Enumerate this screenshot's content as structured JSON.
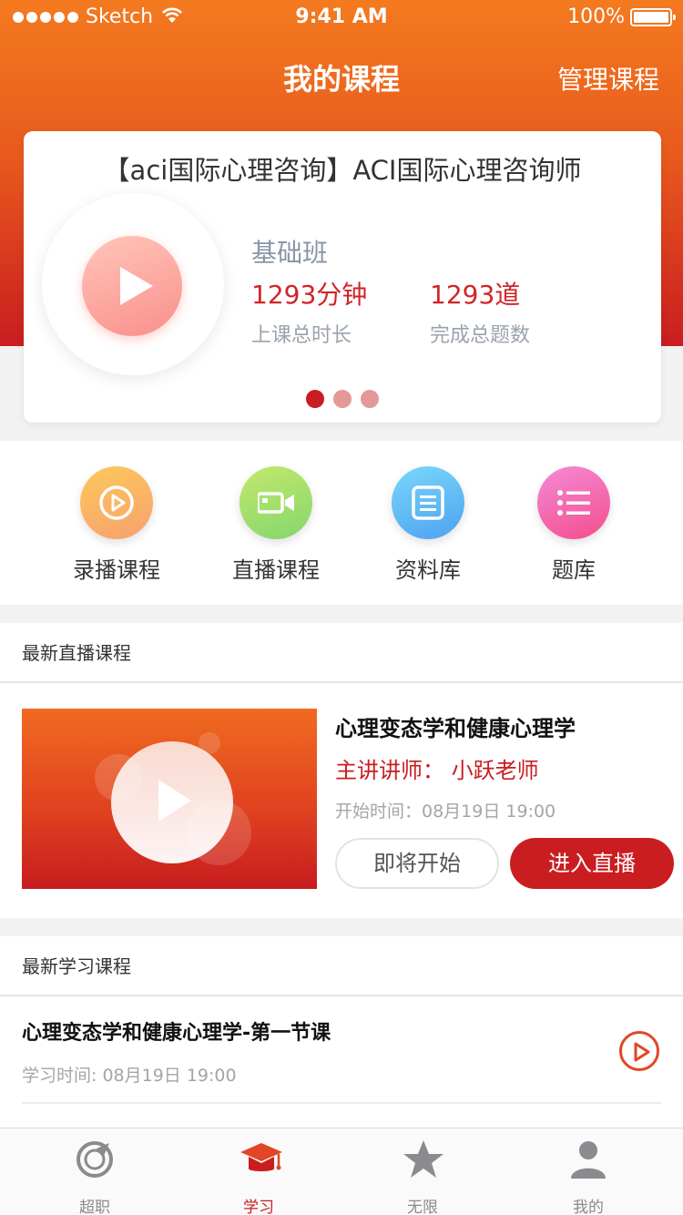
{
  "status_bar": {
    "carrier": "Sketch",
    "time": "9:41 AM",
    "battery": "100%"
  },
  "header": {
    "title": "我的课程",
    "manage_label": "管理课程"
  },
  "summary_card": {
    "title": "【aci国际心理咨询】ACI国际心理咨询师",
    "class_name": "基础班",
    "stats": [
      {
        "value": "1293分钟",
        "label": "上课总时长"
      },
      {
        "value": "1293道",
        "label": "完成总题数"
      }
    ],
    "pager": {
      "total": 3,
      "active": 0
    }
  },
  "quick_entries": [
    {
      "label": "录播课程",
      "icon": "recorded-play-icon"
    },
    {
      "label": "直播课程",
      "icon": "live-camera-icon"
    },
    {
      "label": "资料库",
      "icon": "document-icon"
    },
    {
      "label": "题库",
      "icon": "list-icon"
    }
  ],
  "live_section": {
    "heading": "最新直播课程",
    "course": {
      "title": "心理变态学和健康心理学",
      "teacher": "主讲讲师：  小跃老师",
      "start_time": "开始时间：08月19日 19:00",
      "soon_label": "即将开始",
      "enter_label": "进入直播"
    }
  },
  "learn_section": {
    "heading": "最新学习课程",
    "items": [
      {
        "title": "心理变态学和健康心理学-第一节课",
        "time": "学习时间: 08月19日 19:00"
      }
    ]
  },
  "tab_bar": {
    "tabs": [
      {
        "label": "超职",
        "icon": "chaozhi-logo-icon"
      },
      {
        "label": "学习",
        "icon": "graduation-cap-icon"
      },
      {
        "label": "无限",
        "icon": "star-icon"
      },
      {
        "label": "我的",
        "icon": "person-icon"
      }
    ],
    "active_index": 1
  },
  "colors": {
    "brand_red": "#c91d20",
    "header_orange": "#f47a1f",
    "muted_text": "#a5a5a5"
  }
}
